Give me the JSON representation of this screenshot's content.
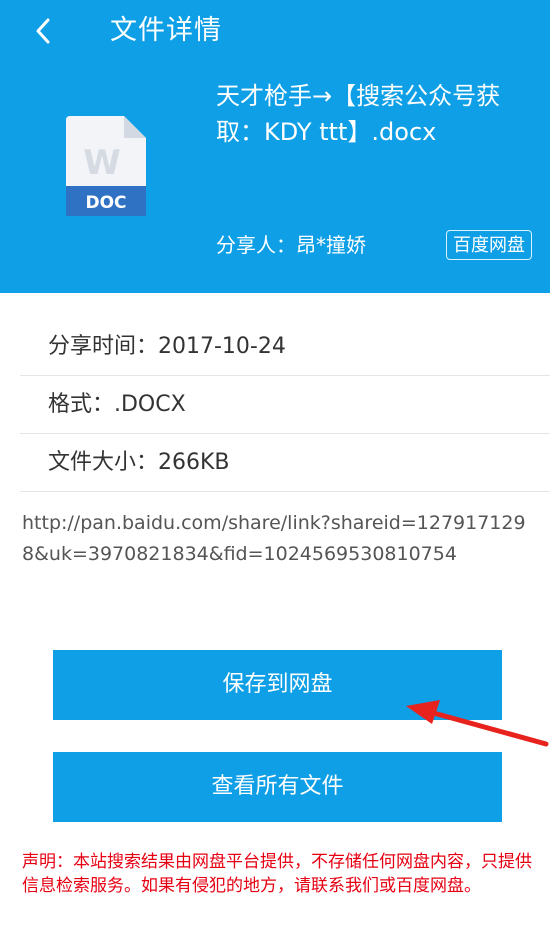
{
  "header": {
    "back_icon": "chevron-left-icon",
    "title": "文件详情",
    "background_color": "#0f9fe6"
  },
  "file": {
    "icon": "word-doc-icon",
    "icon_label": "DOC",
    "icon_letter": "W",
    "name": "天才枪手→【搜索公众号获取：KDY ttt】.docx",
    "sharer": "分享人：昂*撞娇",
    "source": "百度网盘"
  },
  "info": {
    "share_time": "分享时间：2017-10-24",
    "format": "格式：.DOCX",
    "size": "文件大小：266KB"
  },
  "link": "http://pan.baidu.com/share/link?shareid=1279171298&uk=3970821834&fid=1024569530810754",
  "buttons": {
    "save": "保存到网盘",
    "view_all": "查看所有文件"
  },
  "annotation": {
    "arrow_color": "#e8231e"
  },
  "disclaimer": "声明：本站搜索结果由网盘平台提供，不存储任何网盘内容，只提供信息检索服务。如果有侵犯的地方，请联系我们或百度网盘。"
}
